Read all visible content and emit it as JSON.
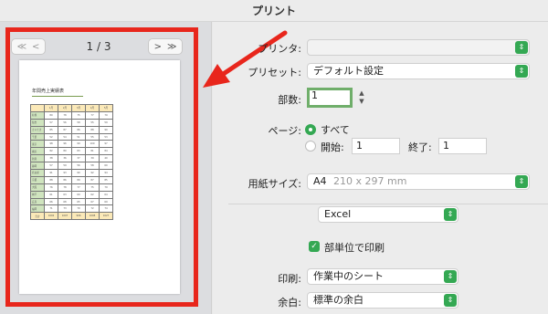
{
  "window": {
    "title": "プリント"
  },
  "preview": {
    "nav": {
      "first": "≪",
      "prev": "<",
      "next": ">",
      "last": "≫"
    },
    "page_counter": "1 / 3",
    "sheet": {
      "title": "年間売上実績表",
      "headers": [
        "",
        "1月",
        "2月",
        "3月",
        "4月",
        "5月"
      ],
      "rows": [
        [
          "札幌",
          "80",
          "78",
          "75",
          "77",
          "79"
        ],
        [
          "仙台",
          "57",
          "56",
          "58",
          "55",
          "59"
        ],
        [
          "さいたま",
          "85",
          "87",
          "86",
          "88",
          "90"
        ],
        [
          "千葉",
          "52",
          "54",
          "51",
          "55",
          "53"
        ],
        [
          "東京",
          "98",
          "96",
          "99",
          "100",
          "97"
        ],
        [
          "横浜",
          "82",
          "80",
          "83",
          "81",
          "84"
        ],
        [
          "新潟",
          "38",
          "36",
          "37",
          "39",
          "40"
        ],
        [
          "静岡",
          "57",
          "59",
          "56",
          "58",
          "60"
        ],
        [
          "名古屋",
          "91",
          "93",
          "90",
          "92",
          "94"
        ],
        [
          "京都",
          "88",
          "86",
          "89",
          "87",
          "85"
        ],
        [
          "大阪",
          "76",
          "78",
          "77",
          "75",
          "79"
        ],
        [
          "神戸",
          "61",
          "63",
          "60",
          "62",
          "64"
        ],
        [
          "広島",
          "66",
          "68",
          "65",
          "67",
          "69"
        ],
        [
          "福岡",
          "71",
          "73",
          "70",
          "72",
          "74"
        ]
      ],
      "total": [
        "合計",
        "1002",
        "1007",
        "996",
        "1008",
        "1027"
      ]
    }
  },
  "form": {
    "printer_label": "プリンタ:",
    "printer_value": "",
    "preset_label": "プリセット:",
    "preset_value": "デフォルト設定",
    "copies_label": "部数:",
    "copies_value": "1",
    "pages_label": "ページ:",
    "pages_all_label": "すべて",
    "pages_from_label": "開始:",
    "pages_from_value": "1",
    "pages_to_label": "終了:",
    "pages_to_value": "1",
    "paper_size_label": "用紙サイズ:",
    "paper_size_value": "A4",
    "paper_size_dims": "210 x 297 mm",
    "app_menu_value": "Excel",
    "per_sheet_label": "部単位で印刷",
    "print_label": "印刷:",
    "print_value": "作業中のシート",
    "margin_label": "余白:",
    "margin_value": "標準の余白"
  },
  "colors": {
    "accent": "#34a853",
    "highlight": "#e8261c"
  }
}
